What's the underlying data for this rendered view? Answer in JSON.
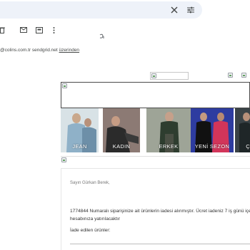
{
  "search": {
    "placeholder": ""
  },
  "toolbar": {
    "icons": [
      "delete-icon",
      "mark-unread-icon",
      "move-to-icon",
      "more-vert-icon"
    ]
  },
  "email": {
    "sender_line": {
      "address": "@colins.com.tr",
      "via_domain": "sendgrid.net",
      "via_label": "üzerinden"
    }
  },
  "newsletter": {
    "categories": [
      {
        "label": "JEAN",
        "bg": "#c9d6dc"
      },
      {
        "label": "KADIN",
        "bg": "#a88f86"
      },
      {
        "label": "ERKEK",
        "bg": "#6f7a6a"
      },
      {
        "label": "YENİ SEZON",
        "bg": "#3b4aa8"
      },
      {
        "label": "Ç",
        "bg": "#2f3a3f"
      }
    ],
    "greeting": "Sayın Gürkan Berek,",
    "message_line1": "1774844 Numaralı siparişinize ait ürünlerin iadesi alınmıştır. Ücret iadeniz 7 iş günü içe",
    "message_line2": "hesabınıza yatırılacaktır",
    "returned_label": "İade edilen ürünler:"
  }
}
